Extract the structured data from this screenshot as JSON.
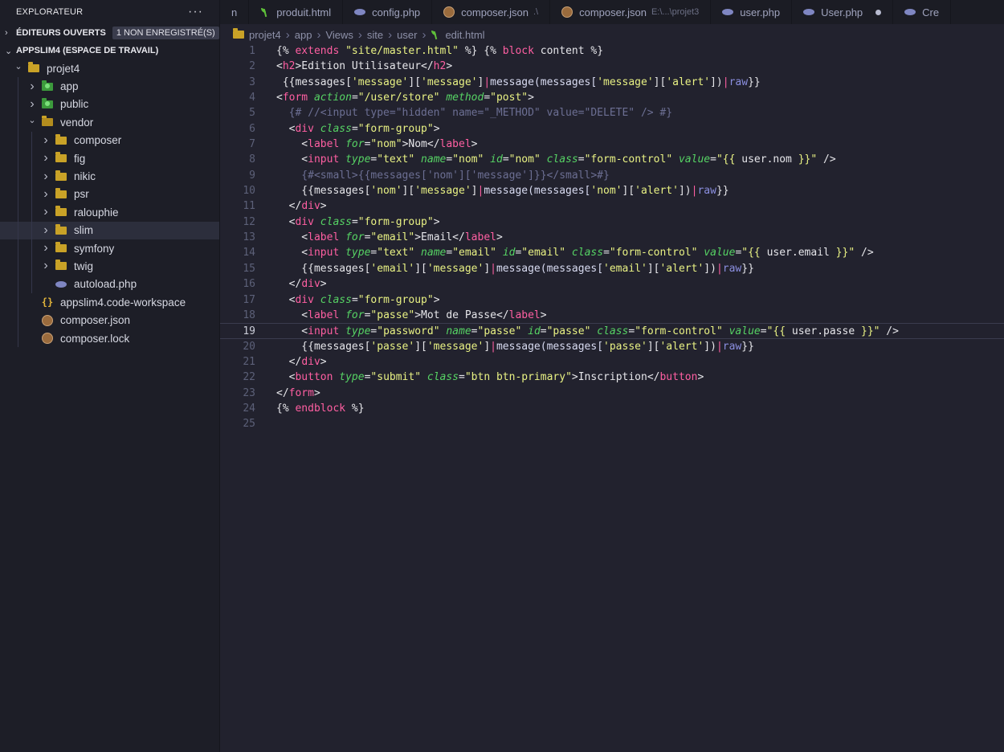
{
  "explorer": {
    "title": "EXPLORATEUR",
    "more": "···",
    "open_editors": "ÉDITEURS OUVERTS",
    "unsaved_badge": "1 NON ENREGISTRÉ(S)",
    "workspace": "APPSLIM4 (ESPACE DE TRAVAIL)"
  },
  "tree": [
    {
      "label": "projet4",
      "depth": 0,
      "kind": "folder-open-special",
      "chev": "down"
    },
    {
      "label": "app",
      "depth": 1,
      "kind": "folder-green",
      "chev": "right"
    },
    {
      "label": "public",
      "depth": 1,
      "kind": "folder-green",
      "chev": "right"
    },
    {
      "label": "vendor",
      "depth": 1,
      "kind": "folder-open",
      "chev": "down"
    },
    {
      "label": "composer",
      "depth": 2,
      "kind": "folder",
      "chev": "right"
    },
    {
      "label": "fig",
      "depth": 2,
      "kind": "folder",
      "chev": "right"
    },
    {
      "label": "nikic",
      "depth": 2,
      "kind": "folder",
      "chev": "right"
    },
    {
      "label": "psr",
      "depth": 2,
      "kind": "folder",
      "chev": "right"
    },
    {
      "label": "ralouphie",
      "depth": 2,
      "kind": "folder",
      "chev": "right"
    },
    {
      "label": "slim",
      "depth": 2,
      "kind": "folder",
      "chev": "right",
      "selected": true
    },
    {
      "label": "symfony",
      "depth": 2,
      "kind": "folder",
      "chev": "right"
    },
    {
      "label": "twig",
      "depth": 2,
      "kind": "folder",
      "chev": "right"
    },
    {
      "label": "autoload.php",
      "depth": 2,
      "kind": "php",
      "chev": ""
    },
    {
      "label": "appslim4.code-workspace",
      "depth": 1,
      "kind": "json",
      "chev": ""
    },
    {
      "label": "composer.json",
      "depth": 1,
      "kind": "composer",
      "chev": ""
    },
    {
      "label": "composer.lock",
      "depth": 1,
      "kind": "composer",
      "chev": ""
    }
  ],
  "tabs": [
    {
      "label": "n",
      "icon": ""
    },
    {
      "label": "produit.html",
      "icon": "twig"
    },
    {
      "label": "config.php",
      "icon": "php"
    },
    {
      "label": "composer.json",
      "icon": "composer",
      "desc": ".\\"
    },
    {
      "label": "composer.json",
      "icon": "composer",
      "desc": "E:\\...\\projet3"
    },
    {
      "label": "user.php",
      "icon": "php"
    },
    {
      "label": "User.php",
      "icon": "php",
      "dirty": true
    },
    {
      "label": "Cre",
      "icon": "php"
    }
  ],
  "breadcrumb": [
    "projet4",
    "app",
    "Views",
    "site",
    "user",
    "edit.html"
  ],
  "current_line": 19,
  "code_lines": [
    [
      [
        "d",
        "{% "
      ],
      [
        "k",
        "extends"
      ],
      [
        "d",
        " "
      ],
      [
        "s",
        "\"site/master.html\""
      ],
      [
        "d",
        " %} {% "
      ],
      [
        "k",
        "block"
      ],
      [
        "d",
        " content %}"
      ]
    ],
    [
      [
        "d",
        "<"
      ],
      [
        "k",
        "h2"
      ],
      [
        "d",
        ">Edition Utilisateur</"
      ],
      [
        "k",
        "h2"
      ],
      [
        "d",
        ">"
      ]
    ],
    [
      [
        "d",
        " {{messages["
      ],
      [
        "s",
        "'message'"
      ],
      [
        "d",
        "]["
      ],
      [
        "s",
        "'message'"
      ],
      [
        "d",
        "]"
      ],
      [
        "k",
        "|"
      ],
      [
        "f",
        "message(messages["
      ],
      [
        "s",
        "'message'"
      ],
      [
        "d",
        "]["
      ],
      [
        "s",
        "'alert'"
      ],
      [
        "d",
        "])"
      ],
      [
        "k",
        "|"
      ],
      [
        "p",
        "raw"
      ],
      [
        "d",
        "}}"
      ]
    ],
    [
      [
        "d",
        "<"
      ],
      [
        "k",
        "form"
      ],
      [
        "d",
        " "
      ],
      [
        "a",
        "action"
      ],
      [
        "d",
        "="
      ],
      [
        "s",
        "\"/user/store\""
      ],
      [
        "d",
        " "
      ],
      [
        "a",
        "method"
      ],
      [
        "d",
        "="
      ],
      [
        "s",
        "\"post\""
      ],
      [
        "d",
        ">"
      ]
    ],
    [
      [
        "c",
        "  {# //<input type=\"hidden\" name=\"_METHOD\" value=\"DELETE\" /> #}"
      ]
    ],
    [
      [
        "d",
        "  <"
      ],
      [
        "k",
        "div"
      ],
      [
        "d",
        " "
      ],
      [
        "a",
        "class"
      ],
      [
        "d",
        "="
      ],
      [
        "s",
        "\"form-group\""
      ],
      [
        "d",
        ">"
      ]
    ],
    [
      [
        "d",
        "    <"
      ],
      [
        "k",
        "label"
      ],
      [
        "d",
        " "
      ],
      [
        "a",
        "for"
      ],
      [
        "d",
        "="
      ],
      [
        "s",
        "\"nom\""
      ],
      [
        "d",
        ">Nom</"
      ],
      [
        "k",
        "label"
      ],
      [
        "d",
        ">"
      ]
    ],
    [
      [
        "d",
        "    <"
      ],
      [
        "k",
        "input"
      ],
      [
        "d",
        " "
      ],
      [
        "a",
        "type"
      ],
      [
        "d",
        "="
      ],
      [
        "s",
        "\"text\""
      ],
      [
        "d",
        " "
      ],
      [
        "a",
        "name"
      ],
      [
        "d",
        "="
      ],
      [
        "s",
        "\"nom\""
      ],
      [
        "d",
        " "
      ],
      [
        "a",
        "id"
      ],
      [
        "d",
        "="
      ],
      [
        "s",
        "\"nom\""
      ],
      [
        "d",
        " "
      ],
      [
        "a",
        "class"
      ],
      [
        "d",
        "="
      ],
      [
        "s",
        "\"form-control\""
      ],
      [
        "d",
        " "
      ],
      [
        "a",
        "value"
      ],
      [
        "d",
        "="
      ],
      [
        "s",
        "\"{{ "
      ],
      [
        "d",
        "user.nom"
      ],
      [
        "s",
        " }}\""
      ],
      [
        "d",
        " />"
      ]
    ],
    [
      [
        "c",
        "    {#<small>{{messages['nom']['message']}}</small>#}"
      ]
    ],
    [
      [
        "d",
        "    {{messages["
      ],
      [
        "s",
        "'nom'"
      ],
      [
        "d",
        "]["
      ],
      [
        "s",
        "'message'"
      ],
      [
        "d",
        "]"
      ],
      [
        "k",
        "|"
      ],
      [
        "f",
        "message(messages["
      ],
      [
        "s",
        "'nom'"
      ],
      [
        "d",
        "]["
      ],
      [
        "s",
        "'alert'"
      ],
      [
        "d",
        "])"
      ],
      [
        "k",
        "|"
      ],
      [
        "p",
        "raw"
      ],
      [
        "d",
        "}}"
      ]
    ],
    [
      [
        "d",
        "  </"
      ],
      [
        "k",
        "div"
      ],
      [
        "d",
        ">"
      ]
    ],
    [
      [
        "d",
        "  <"
      ],
      [
        "k",
        "div"
      ],
      [
        "d",
        " "
      ],
      [
        "a",
        "class"
      ],
      [
        "d",
        "="
      ],
      [
        "s",
        "\"form-group\""
      ],
      [
        "d",
        ">"
      ]
    ],
    [
      [
        "d",
        "    <"
      ],
      [
        "k",
        "label"
      ],
      [
        "d",
        " "
      ],
      [
        "a",
        "for"
      ],
      [
        "d",
        "="
      ],
      [
        "s",
        "\"email\""
      ],
      [
        "d",
        ">Email</"
      ],
      [
        "k",
        "label"
      ],
      [
        "d",
        ">"
      ]
    ],
    [
      [
        "d",
        "    <"
      ],
      [
        "k",
        "input"
      ],
      [
        "d",
        " "
      ],
      [
        "a",
        "type"
      ],
      [
        "d",
        "="
      ],
      [
        "s",
        "\"text\""
      ],
      [
        "d",
        " "
      ],
      [
        "a",
        "name"
      ],
      [
        "d",
        "="
      ],
      [
        "s",
        "\"email\""
      ],
      [
        "d",
        " "
      ],
      [
        "a",
        "id"
      ],
      [
        "d",
        "="
      ],
      [
        "s",
        "\"email\""
      ],
      [
        "d",
        " "
      ],
      [
        "a",
        "class"
      ],
      [
        "d",
        "="
      ],
      [
        "s",
        "\"form-control\""
      ],
      [
        "d",
        " "
      ],
      [
        "a",
        "value"
      ],
      [
        "d",
        "="
      ],
      [
        "s",
        "\"{{ "
      ],
      [
        "d",
        "user.email"
      ],
      [
        "s",
        " }}\""
      ],
      [
        "d",
        " />"
      ]
    ],
    [
      [
        "d",
        "    {{messages["
      ],
      [
        "s",
        "'email'"
      ],
      [
        "d",
        "]["
      ],
      [
        "s",
        "'message'"
      ],
      [
        "d",
        "]"
      ],
      [
        "k",
        "|"
      ],
      [
        "f",
        "message(messages["
      ],
      [
        "s",
        "'email'"
      ],
      [
        "d",
        "]["
      ],
      [
        "s",
        "'alert'"
      ],
      [
        "d",
        "])"
      ],
      [
        "k",
        "|"
      ],
      [
        "p",
        "raw"
      ],
      [
        "d",
        "}}"
      ]
    ],
    [
      [
        "d",
        "  </"
      ],
      [
        "k",
        "div"
      ],
      [
        "d",
        ">"
      ]
    ],
    [
      [
        "d",
        "  <"
      ],
      [
        "k",
        "div"
      ],
      [
        "d",
        " "
      ],
      [
        "a",
        "class"
      ],
      [
        "d",
        "="
      ],
      [
        "s",
        "\"form-group\""
      ],
      [
        "d",
        ">"
      ]
    ],
    [
      [
        "d",
        "    <"
      ],
      [
        "k",
        "label"
      ],
      [
        "d",
        " "
      ],
      [
        "a",
        "for"
      ],
      [
        "d",
        "="
      ],
      [
        "s",
        "\"passe\""
      ],
      [
        "d",
        ">Mot de Passe</"
      ],
      [
        "k",
        "label"
      ],
      [
        "d",
        ">"
      ]
    ],
    [
      [
        "d",
        "    <"
      ],
      [
        "k",
        "input"
      ],
      [
        "d",
        " "
      ],
      [
        "a",
        "type"
      ],
      [
        "d",
        "="
      ],
      [
        "s",
        "\"password\""
      ],
      [
        "d",
        " "
      ],
      [
        "a",
        "name"
      ],
      [
        "d",
        "="
      ],
      [
        "s",
        "\"passe\""
      ],
      [
        "d",
        " "
      ],
      [
        "a",
        "id"
      ],
      [
        "d",
        "="
      ],
      [
        "s",
        "\"passe\""
      ],
      [
        "d",
        " "
      ],
      [
        "a",
        "class"
      ],
      [
        "d",
        "="
      ],
      [
        "s",
        "\"form-control\""
      ],
      [
        "d",
        " "
      ],
      [
        "a",
        "value"
      ],
      [
        "d",
        "="
      ],
      [
        "s",
        "\"{{ "
      ],
      [
        "d",
        "user.passe"
      ],
      [
        "s",
        " }}\""
      ],
      [
        "d",
        " />"
      ]
    ],
    [
      [
        "d",
        "    {{messages["
      ],
      [
        "s",
        "'passe'"
      ],
      [
        "d",
        "]["
      ],
      [
        "s",
        "'message'"
      ],
      [
        "d",
        "]"
      ],
      [
        "k",
        "|"
      ],
      [
        "f",
        "message(messages["
      ],
      [
        "s",
        "'passe'"
      ],
      [
        "d",
        "]["
      ],
      [
        "s",
        "'alert'"
      ],
      [
        "d",
        "])"
      ],
      [
        "k",
        "|"
      ],
      [
        "p",
        "raw"
      ],
      [
        "d",
        "}}"
      ]
    ],
    [
      [
        "d",
        "  </"
      ],
      [
        "k",
        "div"
      ],
      [
        "d",
        ">"
      ]
    ],
    [
      [
        "d",
        "  <"
      ],
      [
        "k",
        "button"
      ],
      [
        "d",
        " "
      ],
      [
        "a",
        "type"
      ],
      [
        "d",
        "="
      ],
      [
        "s",
        "\"submit\""
      ],
      [
        "d",
        " "
      ],
      [
        "a",
        "class"
      ],
      [
        "d",
        "="
      ],
      [
        "s",
        "\"btn btn-primary\""
      ],
      [
        "d",
        ">Inscription</"
      ],
      [
        "k",
        "button"
      ],
      [
        "d",
        ">"
      ]
    ],
    [
      [
        "d",
        "</"
      ],
      [
        "k",
        "form"
      ],
      [
        "d",
        ">"
      ]
    ],
    [
      [
        "d",
        "{% "
      ],
      [
        "k",
        "endblock"
      ],
      [
        "d",
        " %}"
      ]
    ],
    [
      [
        "d",
        ""
      ]
    ]
  ]
}
